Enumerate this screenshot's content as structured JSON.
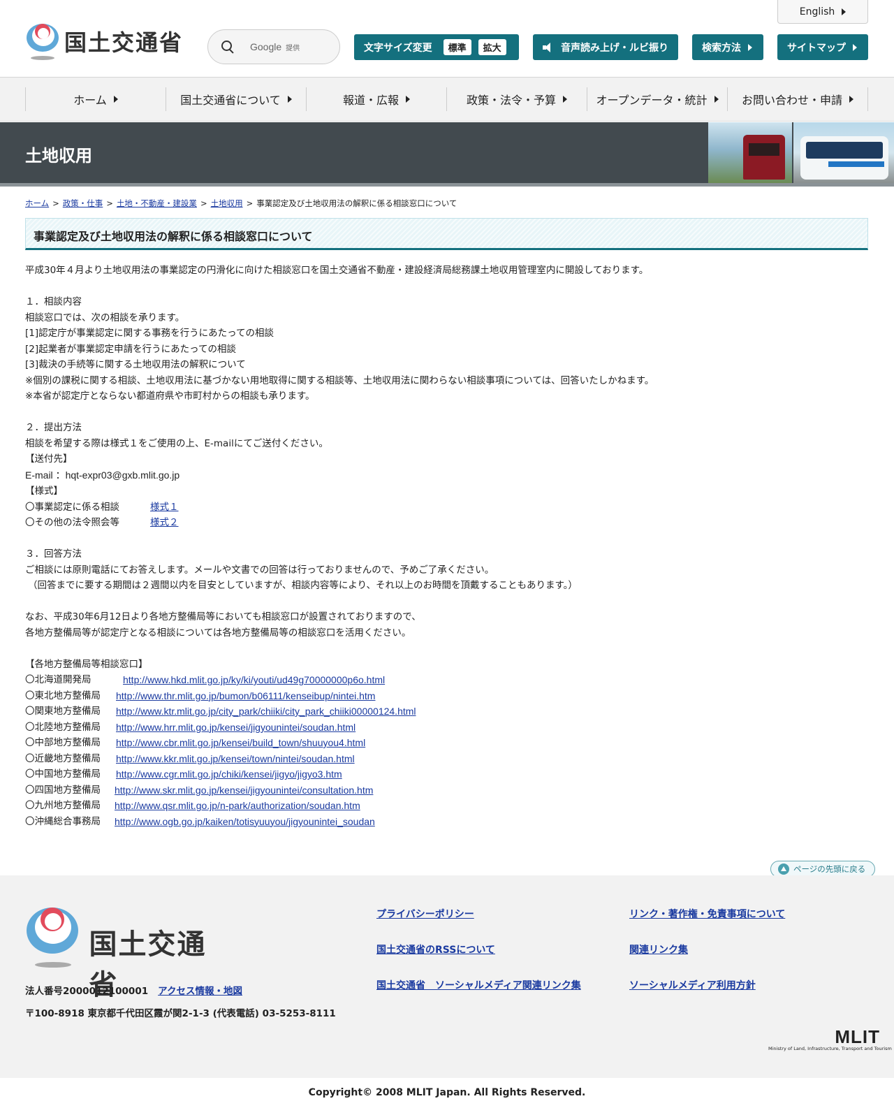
{
  "header": {
    "logo_text": "国土交通省",
    "search": {
      "google": "Google",
      "provided": "提供"
    },
    "english": "English",
    "font_size": {
      "label": "文字サイズ変更",
      "standard": "標準",
      "large": "拡大"
    },
    "speech": "音声読み上げ・ルビ振り",
    "search_help": "検索方法",
    "sitemap": "サイトマップ"
  },
  "nav": [
    {
      "label": "ホーム"
    },
    {
      "label": "国土交通省について"
    },
    {
      "label": "報道・広報"
    },
    {
      "label": "政策・法令・予算"
    },
    {
      "label": "オープンデータ・統計"
    },
    {
      "label": "お問い合わせ・申請"
    }
  ],
  "banner": {
    "title": "土地収用"
  },
  "breadcrumb": {
    "items": [
      "ホーム",
      "政策・仕事",
      "土地・不動産・建設業",
      "土地収用"
    ],
    "current": "事業認定及び土地収用法の解釈に係る相談窓口について",
    "sep": ">"
  },
  "page_title": "事業認定及び土地収用法の解釈に係る相談窓口について",
  "content": {
    "intro": "平成30年４月より土地収用法の事業認定の円滑化に向けた相談窓口を国土交通省不動産・建設経済局総務課土地収用管理室内に開設しております。",
    "s1": {
      "heading": "１．相談内容",
      "lines": [
        "相談窓口では、次の相談を承ります。",
        "[1]認定庁が事業認定に関する事務を行うにあたっての相談",
        "[2]起業者が事業認定申請を行うにあたっての相談",
        "[3]裁決の手続等に関する土地収用法の解釈について",
        "※個別の課税に関する相談、土地収用法に基づかない用地取得に関する相談等、土地収用法に関わらない相談事項については、回答いたしかねます。",
        "※本省が認定庁とならない都道府県や市町村からの相談も承ります。"
      ]
    },
    "s2": {
      "heading": "２．提出方法",
      "line": "相談を希望する際は様式１をご使用の上、E-mailにてご送付ください。",
      "dest_label": "【送付先】",
      "email_prefix": "E-mail ：",
      "email": "hqt-expr03@gxb.mlit.go.jp",
      "form_label": "【様式】",
      "forms": [
        {
          "label": "〇事業認定に係る相談",
          "link": "様式１"
        },
        {
          "label": "〇その他の法令照会等",
          "link": "様式２"
        }
      ]
    },
    "s3": {
      "heading": "３．回答方法",
      "line1": "ご相談には原則電話にてお答えします。メールや文書での回答は行っておりませんので、予めご了承ください。",
      "line2": "（回答までに要する期間は２週間以内を目安としていますが、相談内容等により、それ以上のお時間を頂戴することもあります。）"
    },
    "note1": "なお、平成30年6月12日より各地方整備局等においても相談窓口が設置されておりますので、",
    "note2": "各地方整備局等が認定庁となる相談については各地方整備局等の相談窓口を活用ください。",
    "regional_heading": "【各地方整備局等相談窓口】",
    "regional": [
      {
        "label": "〇北海道開発局",
        "url": "http://www.hkd.mlit.go.jp/ky/ki/youti/ud49g70000000p6o.html"
      },
      {
        "label": "〇東北地方整備局",
        "url": "http://www.thr.mlit.go.jp/bumon/b06111/kenseibup/nintei.htm"
      },
      {
        "label": "〇関東地方整備局",
        "url": "http://www.ktr.mlit.go.jp/city_park/chiiki/city_park_chiiki00000124.html"
      },
      {
        "label": "〇北陸地方整備局",
        "url": "http://www.hrr.mlit.go.jp/kensei/jigyounintei/soudan.html"
      },
      {
        "label": "〇中部地方整備局",
        "url": "http://www.cbr.mlit.go.jp/kensei/build_town/shuuyou4.html"
      },
      {
        "label": "〇近畿地方整備局",
        "url": "http://www.kkr.mlit.go.jp/kensei/town/nintei/soudan.html"
      },
      {
        "label": "〇中国地方整備局",
        "url": "http://www.cgr.mlit.go.jp/chiki/kensei/jigyo/jigyo3.htm"
      },
      {
        "label": "〇四国地方整備局",
        "url": "http://www.skr.mlit.go.jp/kensei/jigyounintei/consultation.htm"
      },
      {
        "label": "〇九州地方整備局",
        "url": "http://www.qsr.mlit.go.jp/n-park/authorization/soudan.htm"
      },
      {
        "label": "〇沖縄総合事務局",
        "url": "http://www.ogb.go.jp/kaiken/totisyuuyou/jigyounintei_soudan"
      }
    ]
  },
  "to_top": "ページの先頭に戻る",
  "footer": {
    "logo_text": "国土交通省",
    "corp_number": "法人番号2000012100001",
    "access": "アクセス情報・地図",
    "address": "〒100-8918 東京都千代田区霞が関2-1-3 (代表電話) 03-5253-8111",
    "links": {
      "privacy": "プライバシーポリシー",
      "rss": "国土交通省のRSSについて",
      "social": "国土交通省　ソーシャルメディア関連リンク集",
      "copyright_info": "リンク・著作権・免責事項について",
      "related": "関連リンク集",
      "social_policy": "ソーシャルメディア利用方針"
    },
    "mlit_mark": "MLIT",
    "mlit_sub": "Ministry of Land, Infrastructure, Transport and Tourism",
    "copyright": "Copyright© 2008 MLIT Japan. All Rights Reserved."
  }
}
